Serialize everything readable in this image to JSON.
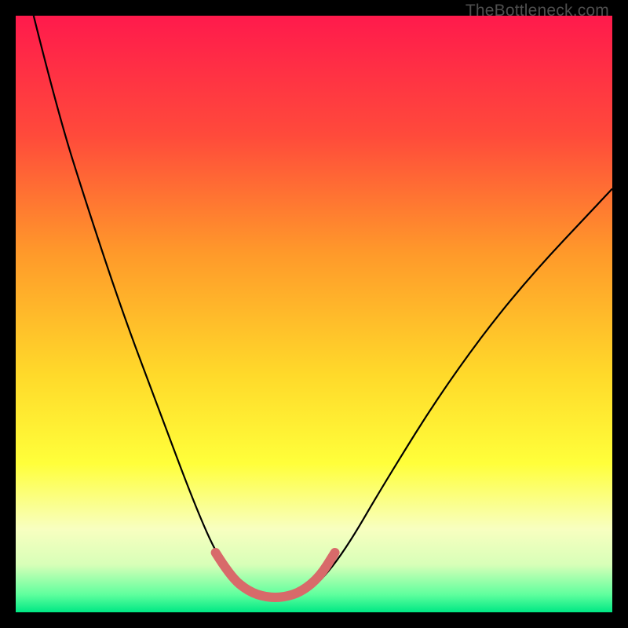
{
  "watermark": "TheBottleneck.com",
  "chart_data": {
    "type": "line",
    "title": "",
    "xlabel": "",
    "ylabel": "",
    "xlim": [
      0,
      100
    ],
    "ylim": [
      0,
      100
    ],
    "gradient_stops": [
      {
        "offset": 0,
        "color": "#ff1a4c"
      },
      {
        "offset": 20,
        "color": "#ff4a3b"
      },
      {
        "offset": 40,
        "color": "#ff9a2a"
      },
      {
        "offset": 60,
        "color": "#ffd92a"
      },
      {
        "offset": 75,
        "color": "#ffff3a"
      },
      {
        "offset": 86,
        "color": "#f8ffc0"
      },
      {
        "offset": 92,
        "color": "#d8ffb8"
      },
      {
        "offset": 97,
        "color": "#60ff9e"
      },
      {
        "offset": 100,
        "color": "#00e884"
      }
    ],
    "series": [
      {
        "name": "bottleneck-curve",
        "stroke": "#000000",
        "points": [
          {
            "x": 3,
            "y": 100
          },
          {
            "x": 7,
            "y": 84
          },
          {
            "x": 12,
            "y": 68
          },
          {
            "x": 18,
            "y": 50
          },
          {
            "x": 24,
            "y": 34
          },
          {
            "x": 30,
            "y": 18
          },
          {
            "x": 34,
            "y": 9
          },
          {
            "x": 38,
            "y": 4
          },
          {
            "x": 42,
            "y": 2
          },
          {
            "x": 46,
            "y": 2
          },
          {
            "x": 50,
            "y": 4
          },
          {
            "x": 55,
            "y": 10
          },
          {
            "x": 62,
            "y": 22
          },
          {
            "x": 72,
            "y": 38
          },
          {
            "x": 84,
            "y": 54
          },
          {
            "x": 100,
            "y": 71
          }
        ]
      },
      {
        "name": "highlight-arc",
        "stroke": "#d86a6a",
        "points": [
          {
            "x": 33.5,
            "y": 10
          },
          {
            "x": 36,
            "y": 6
          },
          {
            "x": 39,
            "y": 3.5
          },
          {
            "x": 42,
            "y": 2.5
          },
          {
            "x": 45,
            "y": 2.5
          },
          {
            "x": 48,
            "y": 3.5
          },
          {
            "x": 51,
            "y": 6
          },
          {
            "x": 53.5,
            "y": 10
          }
        ]
      }
    ]
  }
}
